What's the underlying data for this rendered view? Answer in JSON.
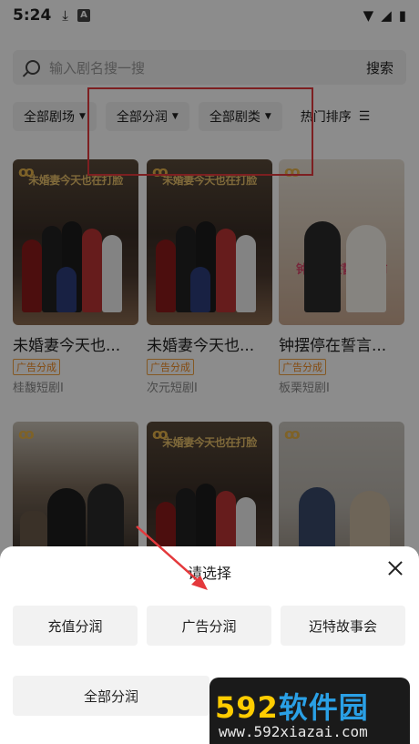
{
  "status": {
    "time": "5:24"
  },
  "search": {
    "placeholder": "输入剧名搜一搜",
    "button": "搜索"
  },
  "filters": [
    {
      "label": "全部剧场"
    },
    {
      "label": "全部分润"
    },
    {
      "label": "全部剧类"
    }
  ],
  "sort": {
    "label": "热门排序"
  },
  "cards": [
    {
      "poster_title": "未婚妻今天也在打脸",
      "title": "未婚妻今天也...",
      "tag": "广告分成",
      "source": "桂馥短剧I"
    },
    {
      "poster_title": "未婚妻今天也在打脸",
      "title": "未婚妻今天也...",
      "tag": "广告分成",
      "source": "次元短剧I"
    },
    {
      "poster_title": "钟摆停在誓言之前",
      "title": "钟摆停在誓言...",
      "tag": "广告分成",
      "source": "板栗短剧I"
    },
    {
      "poster_title": "",
      "title": "",
      "tag": "",
      "source": ""
    },
    {
      "poster_title": "未婚妻今天也在打脸",
      "title": "",
      "tag": "",
      "source": ""
    },
    {
      "poster_title": "",
      "title": "",
      "tag": "",
      "source": ""
    }
  ],
  "sheet": {
    "title": "请选择",
    "options": [
      "充值分润",
      "广告分润",
      "迈特故事会",
      "全部分润"
    ]
  },
  "watermark": {
    "brand_digits": "592",
    "brand_text": "软件园",
    "url": "www.592xiazai.com"
  }
}
